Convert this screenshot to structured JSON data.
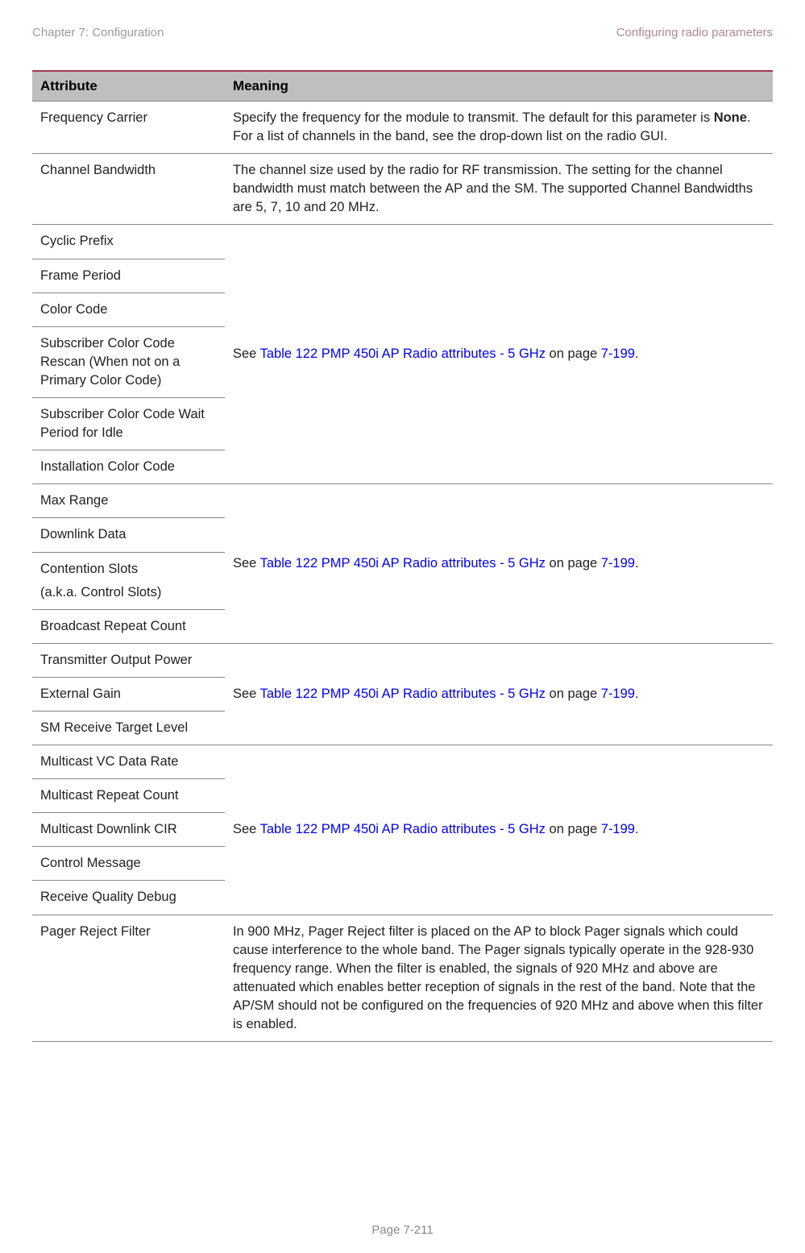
{
  "header": {
    "left": "Chapter 7:  Configuration",
    "right": "Configuring radio parameters"
  },
  "columns": {
    "attribute": "Attribute",
    "meaning": "Meaning"
  },
  "rows": {
    "freq_carrier": {
      "attr": "Frequency Carrier",
      "meaning_prefix": "Specify the frequency for the module to transmit. The default for this parameter is ",
      "meaning_bold": "None",
      "meaning_suffix": ". For a list of channels in the band, see the drop-down list on the radio GUI."
    },
    "channel_bw": {
      "attr": "Channel Bandwidth",
      "meaning": "The channel size used by the radio for RF transmission. The setting for the channel bandwidth must match between the AP and the SM. The supported Channel Bandwidths are 5, 7, 10 and 20 MHz."
    },
    "cyclic_prefix": {
      "attr": "Cyclic Prefix"
    },
    "frame_period": {
      "attr": "Frame Period"
    },
    "color_code": {
      "attr": "Color Code"
    },
    "scc_rescan": {
      "attr": "Subscriber Color Code Rescan (When not on a Primary Color Code)"
    },
    "scc_wait": {
      "attr": "Subscriber Color Code Wait Period for Idle"
    },
    "inst_color": {
      "attr": "Installation Color Code"
    },
    "max_range": {
      "attr": "Max Range"
    },
    "downlink_data": {
      "attr": "Downlink Data"
    },
    "contention_slots": {
      "attr": "Contention Slots",
      "attr_sub": "(a.k.a. Control Slots)"
    },
    "broadcast_repeat": {
      "attr": "Broadcast Repeat Count"
    },
    "tx_out_power": {
      "attr": "Transmitter Output Power"
    },
    "external_gain": {
      "attr": "External Gain"
    },
    "sm_rx_tgt": {
      "attr": "SM Receive Target Level"
    },
    "mc_vc_rate": {
      "attr": "Multicast VC Data Rate"
    },
    "mc_repeat": {
      "attr": "Multicast Repeat Count"
    },
    "mc_dl_cir": {
      "attr": "Multicast Downlink CIR"
    },
    "ctrl_msg": {
      "attr": "Control Message"
    },
    "rx_quality_dbg": {
      "attr": "Receive Quality Debug"
    },
    "pager_reject": {
      "attr": "Pager Reject Filter",
      "meaning": "In 900 MHz, Pager Reject filter is placed on the AP to block  Pager signals which could cause interference to the whole band. The Pager signals typically operate in the 928-930 frequency range. When the filter is enabled, the signals of 920 MHz and above are attenuated which enables better reception of signals in the rest of the band. Note that the AP/SM should not be configured on the frequencies of 920 MHz and above when this filter is enabled."
    }
  },
  "ref1": {
    "see": "See ",
    "link": "Table 122 PMP 450i AP Radio attributes - 5 ",
    "link2": "GHz ",
    "on": " on page ",
    "page": "7-199",
    "dot": "."
  },
  "ref2": {
    "see": "See ",
    "link": "Table 122 PMP 450i AP Radio attributes - 5 GHz ",
    "on": " on page ",
    "page": "7-199",
    "dot": "."
  },
  "ref3": {
    "see": "See ",
    "link": "Table 122 PMP 450i AP Radio attributes - 5 GHz ",
    "on": " on page ",
    "page": "7-199",
    "dot": "."
  },
  "ref4": {
    "see": "See ",
    "link": "Table 122 PMP 450i AP Radio attributes - 5 GHz ",
    "on": " on page ",
    "page": "7-199",
    "dot": "."
  },
  "footer": "Page 7-211"
}
